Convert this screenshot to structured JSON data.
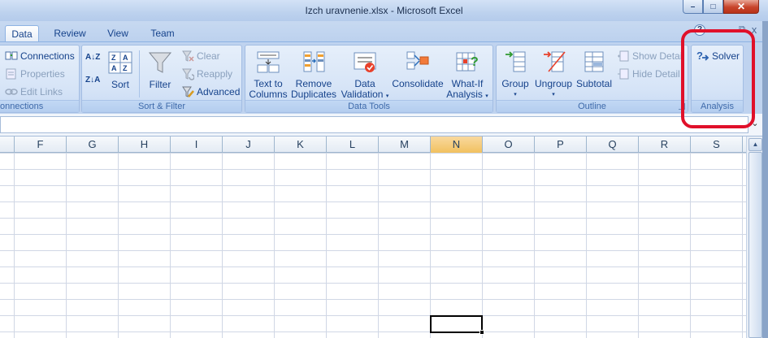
{
  "window": {
    "title": "Izch uravnenie.xlsx - Microsoft Excel",
    "minimize": "–",
    "maximize": "□",
    "close": "✕"
  },
  "tabs": [
    {
      "label": "Data",
      "active": true
    },
    {
      "label": "Review",
      "active": false
    },
    {
      "label": "View",
      "active": false
    },
    {
      "label": "Team",
      "active": false
    }
  ],
  "ribbon_controls": {
    "help": "?",
    "restore": "⧉",
    "close": "x"
  },
  "groups": {
    "connections": {
      "label": "onnections",
      "items": [
        {
          "label": "Connections",
          "icon": "connections-icon",
          "enabled": true
        },
        {
          "label": "Properties",
          "icon": "properties-icon",
          "enabled": false
        },
        {
          "label": "Edit Links",
          "icon": "edit-links-icon",
          "enabled": false
        }
      ]
    },
    "sort_filter": {
      "label": "Sort & Filter",
      "sort_az": "A↓Z",
      "sort_za": "Z↓A",
      "sort": "Sort",
      "filter": "Filter",
      "clear": "Clear",
      "reapply": "Reapply",
      "advanced": "Advanced"
    },
    "data_tools": {
      "label": "Data Tools",
      "text_to_columns": [
        "Text to",
        "Columns"
      ],
      "remove_duplicates": [
        "Remove",
        "Duplicates"
      ],
      "data_validation": [
        "Data",
        "Validation"
      ],
      "consolidate": "Consolidate",
      "what_if": [
        "What-If",
        "Analysis"
      ]
    },
    "outline": {
      "label": "Outline",
      "group": "Group",
      "ungroup": "Ungroup",
      "subtotal": "Subtotal",
      "show_detail": "Show Detail",
      "hide_detail": "Hide Detail"
    },
    "analysis": {
      "label": "Analysis",
      "solver": "Solver"
    }
  },
  "columns": [
    "F",
    "G",
    "H",
    "I",
    "J",
    "K",
    "L",
    "M",
    "N",
    "O",
    "P",
    "Q",
    "R",
    "S"
  ],
  "selected_column": "N",
  "highlight_color": "#e0102a",
  "dropdown_arrow": "▾"
}
